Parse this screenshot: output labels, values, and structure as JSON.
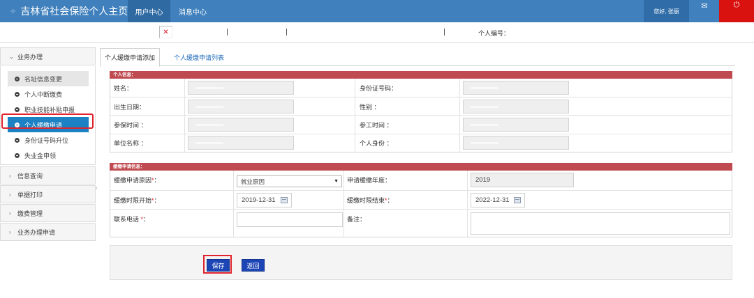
{
  "header": {
    "title": "吉林省社会保险个人主页",
    "nav": [
      "用户中心",
      "消息中心"
    ],
    "greeting": "您好, 张丽",
    "mail_icon": "mail-icon",
    "power_icon": "power-icon"
  },
  "strip": {
    "person_id_label": "个人编号："
  },
  "sidebar": {
    "sections": [
      {
        "label": "业务办理",
        "expanded": true
      },
      {
        "label": "信息查询"
      },
      {
        "label": "单据打印"
      },
      {
        "label": "缴费管理"
      },
      {
        "label": "业务办理申请"
      }
    ],
    "items": [
      "名址信息变更",
      "个人中断缴费",
      "职业技能补贴申报",
      "个人缓缴申请",
      "身份证号码升位",
      "失业金申领"
    ],
    "active_item": "个人缓缴申请"
  },
  "tabs": [
    "个人缓缴申请添加",
    "个人缓缴申请列表"
  ],
  "personal_info": {
    "section_title": "个人信息：",
    "labels": {
      "name": "姓名：",
      "id_number": "身份证号码：",
      "birth_date": "出生日期：",
      "gender": "性别 ：",
      "insured_time": "参保时间 ：",
      "work_start_time": "参工时间 ：",
      "employer": "单位名称 ：",
      "identity": "个人身份 ："
    }
  },
  "deferral_info": {
    "section_title": "缓缴申请信息：",
    "labels": {
      "reason": "缓缴申请原因",
      "year": "申请缓缴年度：",
      "start": "缓缴时限开始",
      "end": "缓缴时限结束",
      "phone": "联系电话 ",
      "remark": "备注："
    },
    "required_mark": "*",
    "colon": "：",
    "values": {
      "reason": "就业原因",
      "year": "2019",
      "start": "2019-12-31",
      "end": "2022-12-31",
      "phone": "",
      "remark": ""
    }
  },
  "buttons": {
    "save": "保存",
    "back": "返回"
  },
  "colors": {
    "header_blue": "#3f80bd",
    "active_blue": "#1d82c3",
    "section_red": "#bf4a4f",
    "button_blue": "#1c46b5",
    "highlight_red": "#e0232e"
  }
}
